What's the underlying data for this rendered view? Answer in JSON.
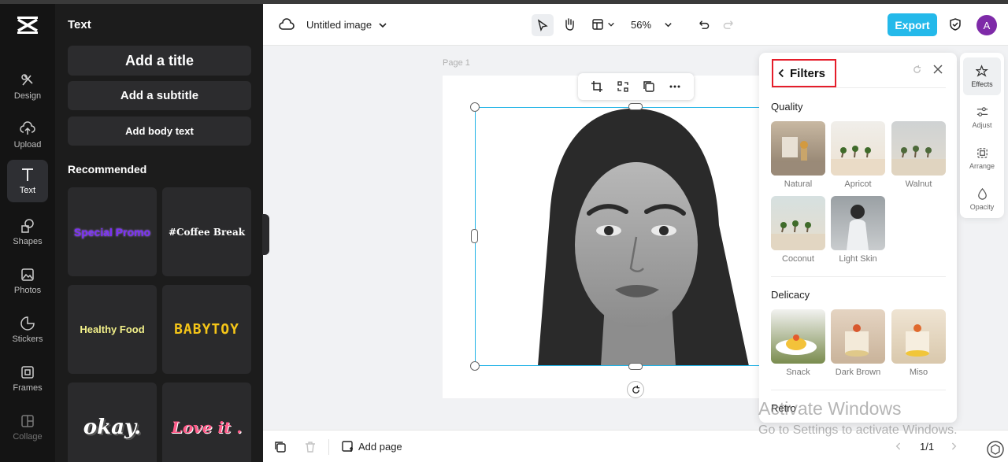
{
  "topbar": {
    "doc_title": "Untitled image",
    "zoom": "56%",
    "export_label": "Export",
    "avatar_initial": "A"
  },
  "rail": {
    "items": [
      {
        "label": "Design",
        "icon": "design-icon"
      },
      {
        "label": "Upload",
        "icon": "upload-icon"
      },
      {
        "label": "Text",
        "icon": "text-icon"
      },
      {
        "label": "Shapes",
        "icon": "shapes-icon"
      },
      {
        "label": "Photos",
        "icon": "photos-icon"
      },
      {
        "label": "Stickers",
        "icon": "stickers-icon"
      },
      {
        "label": "Frames",
        "icon": "frames-icon"
      },
      {
        "label": "Collage",
        "icon": "collage-icon"
      }
    ],
    "active": "Text"
  },
  "panel": {
    "title": "Text",
    "add_title": "Add a title",
    "add_subtitle": "Add a subtitle",
    "add_body": "Add body text",
    "recommended_title": "Recommended",
    "cards": [
      {
        "text": "Special Promo",
        "color": "#7b2ff7"
      },
      {
        "text": "#Coffee Break",
        "color": "#ffffff"
      },
      {
        "text": "Healthy Food",
        "color": "#f2f08a"
      },
      {
        "text": "BABYTOY",
        "color": "#f5c518"
      },
      {
        "text": "okay.",
        "color": "#ffffff"
      },
      {
        "text": "Love it .",
        "color": "#ff5c8a"
      }
    ]
  },
  "canvas": {
    "page_label": "Page 1"
  },
  "filters": {
    "title": "Filters",
    "sections": [
      {
        "name": "Quality",
        "items": [
          "Natural",
          "Apricot",
          "Walnut",
          "Coconut",
          "Light Skin"
        ]
      },
      {
        "name": "Delicacy",
        "items": [
          "Snack",
          "Dark Brown",
          "Miso"
        ]
      },
      {
        "name": "Retro",
        "items": []
      }
    ]
  },
  "right_tools": [
    {
      "label": "Effects",
      "icon": "effects-icon"
    },
    {
      "label": "Adjust",
      "icon": "adjust-icon"
    },
    {
      "label": "Arrange",
      "icon": "arrange-icon"
    },
    {
      "label": "Opacity",
      "icon": "opacity-icon"
    }
  ],
  "bottombar": {
    "add_page": "Add page",
    "page_indicator": "1/1"
  },
  "watermark": {
    "line1": "Activate Windows",
    "line2": "Go to Settings to activate Windows."
  },
  "colors": {
    "accent": "#24b9ea",
    "selection": "#1fb2e6",
    "highlight_box": "#e51d2a"
  }
}
